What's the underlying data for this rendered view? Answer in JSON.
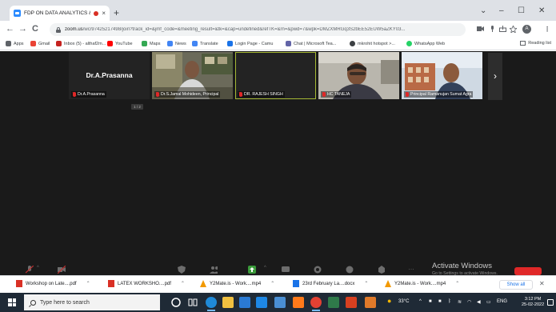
{
  "browser": {
    "tab": {
      "title": "FDP ON DATA ANALYTICS &",
      "close": "×"
    },
    "new_tab": "+",
    "window_controls": {
      "minimize": "–",
      "maximize": "☐",
      "close": "✕",
      "tab_search": "⌄"
    },
    "nav": {
      "back": "←",
      "forward": "→",
      "reload": "C"
    },
    "url_host": "zoom.us",
    "url_rest": "/wc/97425217498/join?track_id=&jmf_code=&meeting_result=&tk=&cap=undefined&refTK=&rn=&pwd=7&wpk=DMZXMRGq3S2bEE52EUW5aZKY03...",
    "profile_initial": "A",
    "bookmarks": [
      {
        "label": "Apps",
        "color": "#5f6368"
      },
      {
        "label": "Gmail",
        "color": "#ea4335"
      },
      {
        "label": "Inbox (5) - althaf2m...",
        "color": "#c5221f"
      },
      {
        "label": "YouTube",
        "color": "#ff0000"
      },
      {
        "label": "Maps",
        "color": "#34a853"
      },
      {
        "label": "News",
        "color": "#4285f4"
      },
      {
        "label": "Translate",
        "color": "#4285f4"
      },
      {
        "label": "Login Page - Camu",
        "color": "#1a73e8"
      },
      {
        "label": "Chat | Microsoft Tea...",
        "color": "#6264a7"
      },
      {
        "label": "mkrohit hotspot >...",
        "color": "#3c4043"
      },
      {
        "label": "WhatsApp Web",
        "color": "#25d366"
      }
    ],
    "reading_list": "Reading list"
  },
  "meeting": {
    "participants": [
      {
        "display": "Dr.A.Prasanna",
        "tag": "Dr.A.Prasanna",
        "video": false,
        "active": false
      },
      {
        "display": "",
        "tag": "Dr.S.Jamal Mohideen, Principal",
        "video": true,
        "active": false
      },
      {
        "display": "",
        "tag": "DR. RAJESH SINGH",
        "video": false,
        "active": true
      },
      {
        "display": "",
        "tag": "HC TANEJA",
        "video": true,
        "active": false
      },
      {
        "display": "",
        "tag": "Principal Ramanujan Sumat Agra",
        "video": true,
        "active": false
      }
    ],
    "next_page": "›",
    "page_badge": "1 / 2",
    "activate_title": "Activate Windows",
    "activate_sub": "Go to Settings to activate Windows."
  },
  "downloads": [
    {
      "name": "Workshop on Late....pdf",
      "color": "#d93025"
    },
    {
      "name": "LATEX WORKSHO....pdf",
      "color": "#d93025"
    },
    {
      "name": "Y2Mate.is - Work....mp4",
      "color": "#f29900"
    },
    {
      "name": "23rd February La....docx",
      "color": "#1a73e8"
    },
    {
      "name": "Y2Mate.is - Work....mp4",
      "color": "#f29900"
    }
  ],
  "downloads_show_all": "Show all",
  "downloads_close": "✕",
  "taskbar": {
    "search_placeholder": "Type here to search",
    "weather": "33°C",
    "language": "ENG",
    "time": "3:12 PM",
    "date": "25-02-2022"
  }
}
